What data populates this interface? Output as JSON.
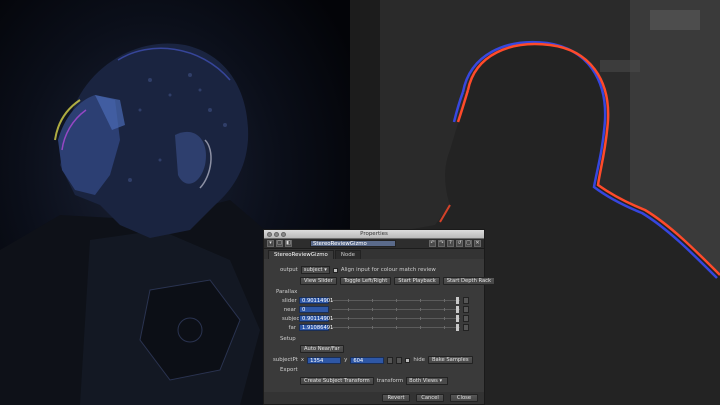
{
  "window": {
    "title": "Properties"
  },
  "toolbar": {
    "node_name": "StereoReviewGizmo"
  },
  "tabs": [
    {
      "label": "StereoReviewGizmo"
    },
    {
      "label": "Node"
    }
  ],
  "output": {
    "label": "output",
    "value": "subject",
    "align_checkbox_label": "Align input for colour match review"
  },
  "buttons": {
    "view_slider": "View Slider",
    "toggle_lr": "Toggle Left/Right",
    "start_playback": "Start Playback",
    "start_depth_rack": "Start Depth Rack"
  },
  "parallax": {
    "section_label": "Parallax",
    "rows": [
      {
        "label": "slider",
        "value": "0.90114901"
      },
      {
        "label": "near",
        "value": "0"
      },
      {
        "label": "subject",
        "value": "0.90114901"
      },
      {
        "label": "far",
        "value": "1.91086491"
      }
    ]
  },
  "setup": {
    "section_label": "Setup",
    "auto_near_far": "Auto Near/Far",
    "subjectpt_label": "subjectPt",
    "x_label": "x",
    "x_value": "1354",
    "y_label": "y",
    "y_value": "604",
    "hide_label": "hide",
    "bake_samples": "Bake Samples"
  },
  "export": {
    "section_label": "Export",
    "create_subject_transform": "Create Subject Transform",
    "transform_label": "transform",
    "transform_value": "Both Views"
  },
  "footer": {
    "revert": "Revert",
    "cancel": "Cancel",
    "close": "Close"
  },
  "colors": {
    "selection_blue": "#2e57a6",
    "outline_red": "#ff4a2a",
    "outline_blue": "#3a4cff"
  }
}
